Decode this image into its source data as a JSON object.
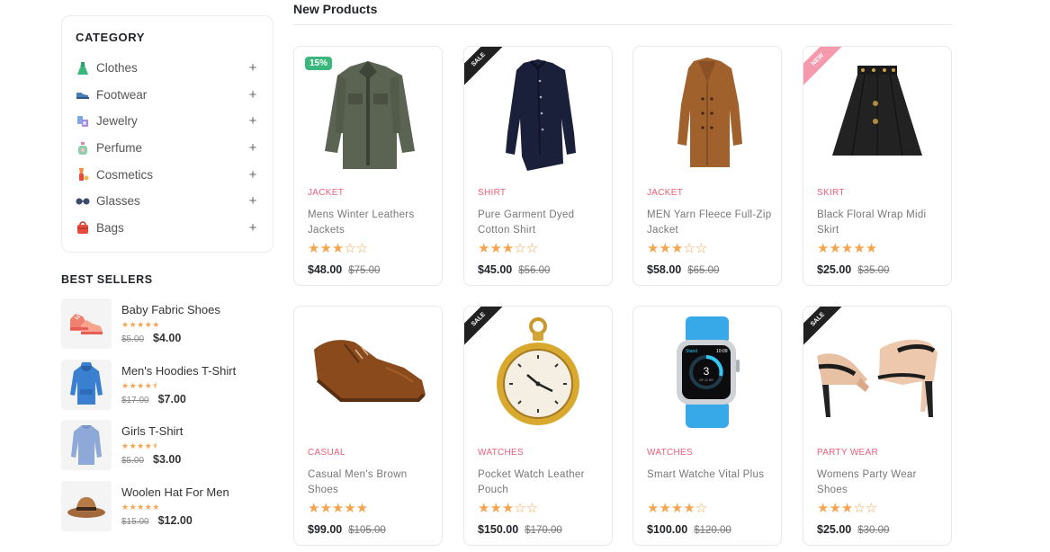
{
  "sidebar": {
    "category_title": "CATEGORY",
    "categories": [
      {
        "label": "Clothes",
        "icon": "dress-icon",
        "expand": "+"
      },
      {
        "label": "Footwear",
        "icon": "shoe-icon",
        "expand": "+"
      },
      {
        "label": "Jewelry",
        "icon": "jewelry-icon",
        "expand": "+"
      },
      {
        "label": "Perfume",
        "icon": "perfume-icon",
        "expand": "+"
      },
      {
        "label": "Cosmetics",
        "icon": "cosmetics-icon",
        "expand": "+"
      },
      {
        "label": "Glasses",
        "icon": "glasses-icon",
        "expand": "+"
      },
      {
        "label": "Bags",
        "icon": "bag-icon",
        "expand": "+"
      }
    ],
    "best_sellers_title": "BEST SELLERS",
    "best_sellers": [
      {
        "name": "Baby Fabric Shoes",
        "stars": "★★★★★",
        "old_price": "$5.00",
        "price": "$4.00",
        "image": "baby-shoes-image"
      },
      {
        "name": "Men's Hoodies T-Shirt",
        "stars": "★★★★⯨",
        "old_price": "$17.00",
        "price": "$7.00",
        "image": "hoodie-image"
      },
      {
        "name": "Girls T-Shirt",
        "stars": "★★★★⯨",
        "old_price": "$5.00",
        "price": "$3.00",
        "image": "tshirt-image"
      },
      {
        "name": "Woolen Hat For Men",
        "stars": "★★★★★",
        "old_price": "$15.00",
        "price": "$12.00",
        "image": "hat-image"
      }
    ]
  },
  "main": {
    "title": "New Products",
    "products": [
      {
        "category": "JACKET",
        "name": "Mens Winter Leathers Jackets",
        "rating": 3,
        "stars": "★★★☆☆",
        "price": "$48.00",
        "old_price": "$75.00",
        "badge": "15%",
        "badge_type": "percent",
        "image": "jacket-image"
      },
      {
        "category": "SHIRT",
        "name": "Pure Garment Dyed Cotton Shirt",
        "rating": 3,
        "stars": "★★★☆☆",
        "price": "$45.00",
        "old_price": "$56.00",
        "badge": "SALE",
        "badge_type": "sale",
        "image": "shirt-image"
      },
      {
        "category": "JACKET",
        "name": "MEN Yarn Fleece Full-Zip Jacket",
        "rating": 3,
        "stars": "★★★☆☆",
        "price": "$58.00",
        "old_price": "$65.00",
        "badge": "",
        "badge_type": "none",
        "image": "coat-image"
      },
      {
        "category": "SKIRT",
        "name": "Black Floral Wrap Midi Skirt",
        "rating": 5,
        "stars": "★★★★★",
        "price": "$25.00",
        "old_price": "$35.00",
        "badge": "NEW",
        "badge_type": "new",
        "image": "skirt-image"
      },
      {
        "category": "CASUAL",
        "name": "Casual Men's Brown Shoes",
        "rating": 5,
        "stars": "★★★★★",
        "price": "$99.00",
        "old_price": "$105.00",
        "badge": "",
        "badge_type": "none",
        "image": "brown-shoe-image"
      },
      {
        "category": "WATCHES",
        "name": "Pocket Watch Leather Pouch",
        "rating": 3,
        "stars": "★★★☆☆",
        "price": "$150.00",
        "old_price": "$170.00",
        "badge": "SALE",
        "badge_type": "sale",
        "image": "pocket-watch-image"
      },
      {
        "category": "WATCHES",
        "name": "Smart Watche Vital Plus",
        "rating": 4,
        "stars": "★★★★☆",
        "price": "$100.00",
        "old_price": "$120.00",
        "badge": "",
        "badge_type": "none",
        "image": "smartwatch-image"
      },
      {
        "category": "PARTY WEAR",
        "name": "Womens Party Wear Shoes",
        "rating": 3,
        "stars": "★★★☆☆",
        "price": "$25.00",
        "old_price": "$30.00",
        "badge": "SALE",
        "badge_type": "sale",
        "image": "heels-image"
      }
    ],
    "smartwatch_screen": {
      "label": "Stand",
      "time": "10:09",
      "value": "3",
      "sub": "OF 12 HR"
    }
  },
  "colors": {
    "accent": "#ee5e7a",
    "star": "#f5a54f",
    "badge_green": "#3bb77e",
    "ribbon_dark": "#212121",
    "ribbon_pink": "#f49aac"
  }
}
